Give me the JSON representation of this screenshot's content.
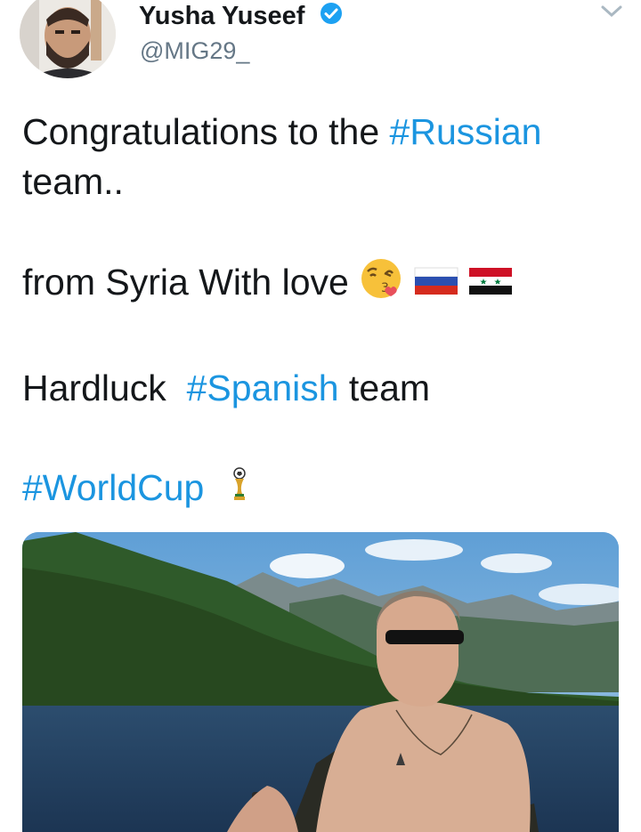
{
  "user": {
    "display_name": "Yusha Yuseef",
    "handle": "@MIG29_"
  },
  "icons": {
    "verified": "verified-badge-icon",
    "menu": "chevron-down-icon",
    "kiss_emoji": "face-blowing-kiss-emoji",
    "russia_flag": "russia-flag-emoji",
    "syria_flag": "syria-flag-emoji",
    "trophy_emoji": "world-cup-trophy-emoji"
  },
  "tweet": {
    "line1_prefix": "Congratulations to the ",
    "hashtag_russian": "#Russian",
    "line1_suffix": "team..",
    "line2": "from Syria With love",
    "line3_prefix": "Hardluck  ",
    "hashtag_spanish": "#Spanish",
    "line3_suffix": " team",
    "hashtag_worldcup": "#WorldCup"
  },
  "colors": {
    "hashtag": "#1b95e0",
    "handle": "#657786",
    "verified": "#1da1f2"
  }
}
